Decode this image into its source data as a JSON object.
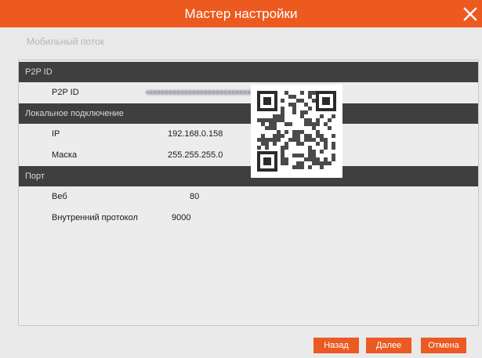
{
  "window": {
    "title": "Мастер настройки",
    "close_icon": "close-icon"
  },
  "section_title": "Мобильный поток",
  "p2p": {
    "header": "P2P ID",
    "label": "P2P ID",
    "value": "8FE45/8KCAF67757T11A"
  },
  "local": {
    "header": "Локальное подключение",
    "ip_label": "IP",
    "ip_value": "192.168.0.158",
    "mask_label": "Маска",
    "mask_value": "255.255.255.0"
  },
  "ports": {
    "header": "Порт",
    "web_label": "Веб",
    "web_value": "80",
    "internal_label": "Внутренний протокол",
    "internal_value": "9000"
  },
  "buttons": {
    "back": "Назад",
    "next": "Далее",
    "cancel": "Отмена"
  },
  "colors": {
    "accent": "#ec5a1f",
    "band": "#3f3f3f",
    "background": "#e9e9e9"
  }
}
